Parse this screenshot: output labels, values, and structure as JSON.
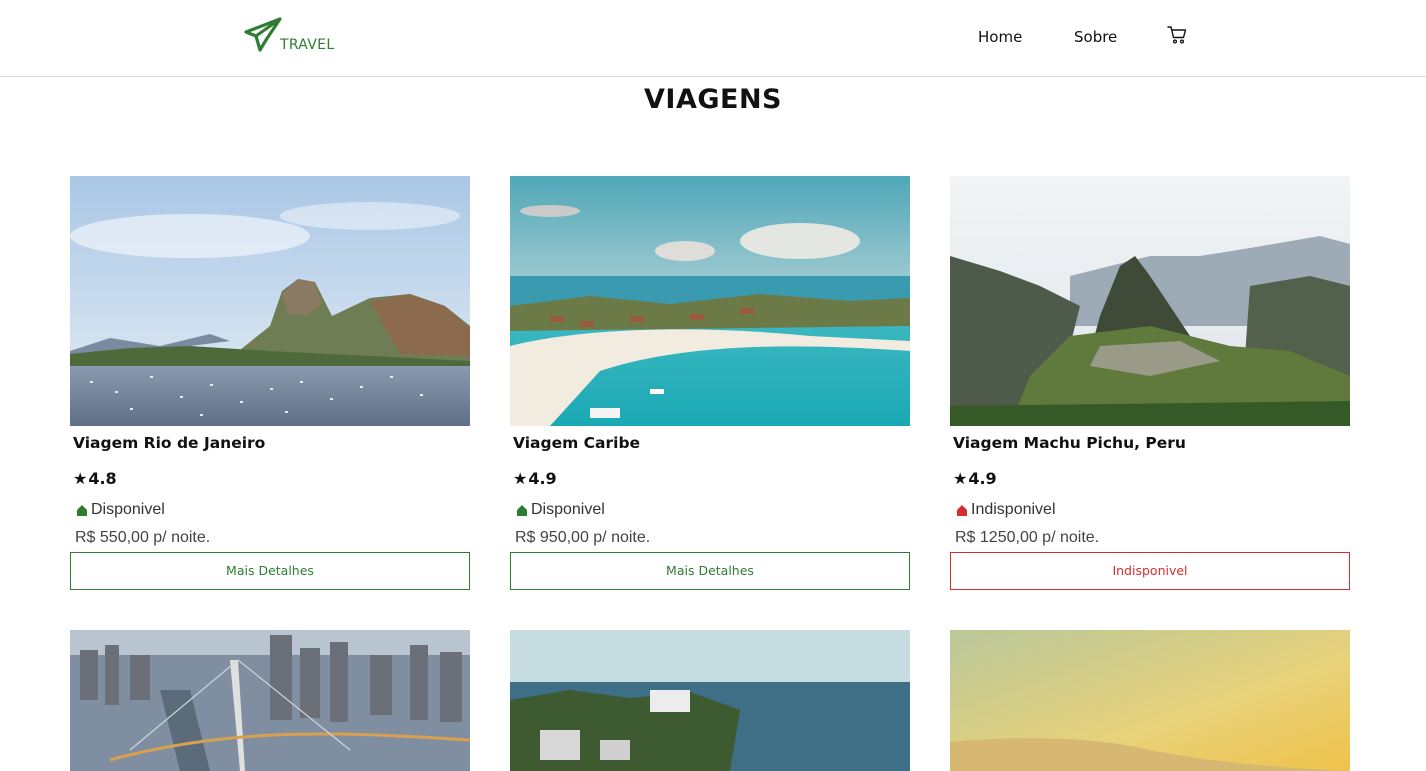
{
  "header": {
    "logo_text": "TRAVEL",
    "nav": {
      "home": "Home",
      "sobre": "Sobre"
    },
    "icons": {
      "logo": "paper-plane-icon",
      "cart": "cart-icon"
    }
  },
  "page_title": "VIAGENS",
  "colors": {
    "accent": "#2e7d32",
    "danger": "#d32f2f"
  },
  "cards": [
    {
      "title": "Viagem Rio de Janeiro",
      "rating": "4.8",
      "status": "Disponivel",
      "price": "R$ 550,00 p/ noite.",
      "button": "Mais Detalhes"
    },
    {
      "title": "Viagem Caribe",
      "rating": "4.9",
      "status": "Disponivel",
      "price": "R$ 950,00 p/ noite.",
      "button": "Mais Detalhes"
    },
    {
      "title": "Viagem Machu Pichu, Peru",
      "rating": "4.9",
      "status": "Indisponivel",
      "price": "R$ 1250,00 p/ noite.",
      "button": "Indisponivel"
    }
  ]
}
